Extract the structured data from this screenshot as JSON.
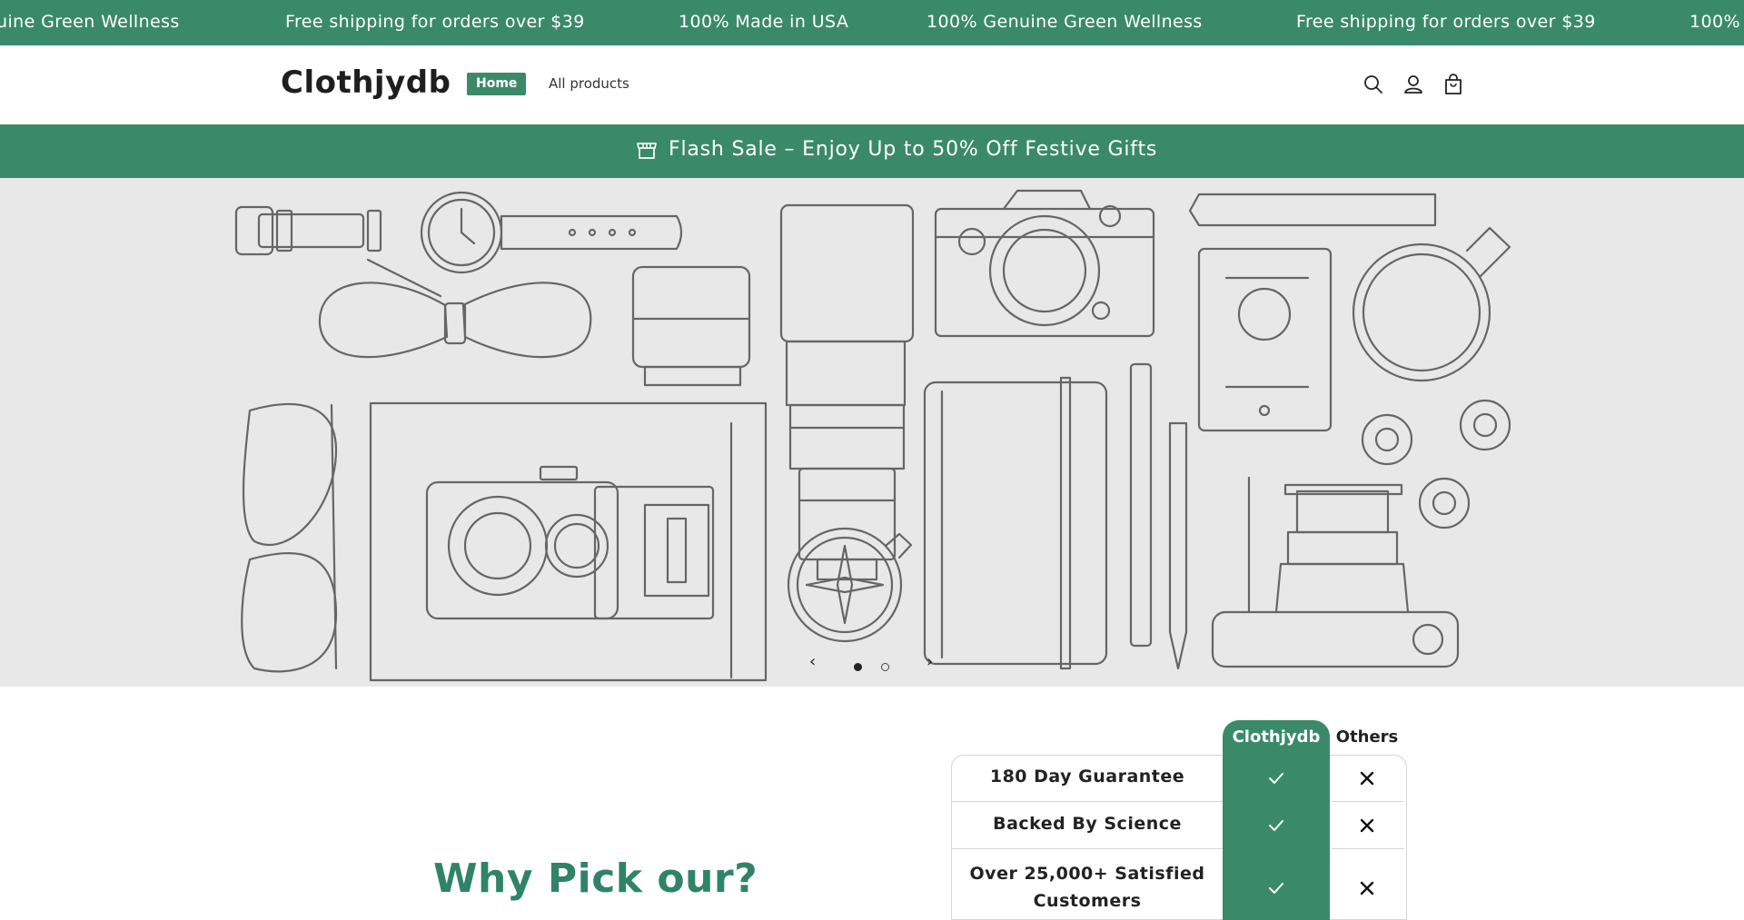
{
  "announcement": {
    "items": [
      "uine Green Wellness",
      "Free shipping for orders over $39",
      "100% Made in USA",
      "100% Genuine Green Wellness",
      "Free shipping for orders over $39",
      "100% M"
    ]
  },
  "header": {
    "logo": "Clothjydb",
    "nav": {
      "home": "Home",
      "all_products": "All products"
    },
    "icons": [
      "search-icon",
      "account-icon",
      "cart-icon"
    ]
  },
  "flash": {
    "icon": "store-icon",
    "text": "Flash Sale – Enjoy Up to 50% Off Festive Gifts"
  },
  "slider": {
    "prev_label": "‹",
    "next_label": "›",
    "active_slide": 1,
    "slide_count": 2
  },
  "comparison": {
    "heading": "Why Pick our?",
    "brand_header": "Clothjydb",
    "others_header": "Others",
    "rows": [
      {
        "label": "180 Day Guarantee",
        "brand": "check-icon",
        "others": "cross-icon"
      },
      {
        "label": "Backed By Science",
        "brand": "check-icon",
        "others": "cross-icon"
      },
      {
        "label": "Over 25,000+ Satisfied Customers",
        "brand": "check-icon",
        "others": "cross-icon"
      }
    ]
  },
  "colors": {
    "accent": "#3a8a6a",
    "hero_bg": "#e8e8e8",
    "heading": "#2f8466"
  }
}
